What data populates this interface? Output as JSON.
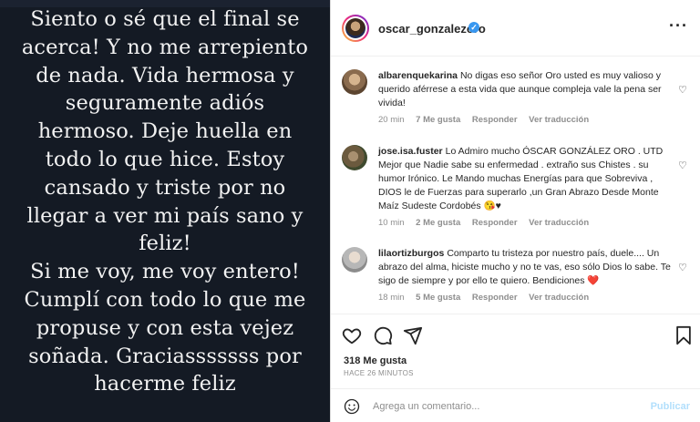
{
  "story": {
    "lines": [
      "Siento o sé que el final se",
      "acerca! Y no me arrepiento",
      "de nada. Vida hermosa y",
      "seguramente adiós",
      "hermoso. Deje huella en",
      "todo lo que hice. Estoy",
      "cansado y triste por no",
      "llegar a ver mi país sano y",
      "feliz!",
      "Si me voy, me voy entero!",
      "Cumplí con todo lo que me",
      "propuse y con esta vejez",
      "soñada. Graciasssssss por",
      "hacerme feliz"
    ]
  },
  "header": {
    "username": "oscar_gonzalezoro",
    "verified_icon": "verified-badge-icon",
    "more_icon": "more-options-icon"
  },
  "comments": [
    {
      "user": "albarenquekarina",
      "text": "No digas eso señor Oro usted es muy valioso y querido aférrese a esta vida que aunque compleja vale la pena ser vivida!",
      "time": "20 min",
      "likes": "7 Me gusta",
      "reply": "Responder",
      "translate": "Ver traducción",
      "avatar_color": "#8a6b4e"
    },
    {
      "user": "jose.isa.fuster",
      "text": "Lo Admiro mucho ÓSCAR GONZÁLEZ ORO . UTD Mejor que Nadie sabe su enfermedad . extraño sus Chistes . su humor Irónico. Le Mando muchas Energías para que Sobreviva , DIOS le de Fuerzas para superarlo ,un Gran Abrazo Desde Monte Maíz Sudeste Cordobés 😘♥",
      "time": "10 min",
      "likes": "2 Me gusta",
      "reply": "Responder",
      "translate": "Ver traducción",
      "avatar_color": "#6b5a3e"
    },
    {
      "user": "lilaortizburgos",
      "text": "Comparto tu tristeza por nuestro país, duele.... Un abrazo del alma, hiciste mucho y no te vas, eso sólo Dios lo sabe. Te sigo de siempre y por ello te quiero. Bendiciones ❤️",
      "time": "18 min",
      "likes": "5 Me gusta",
      "reply": "Responder",
      "translate": "Ver traducción",
      "avatar_color": "#b7b7b7"
    }
  ],
  "actions": {
    "like_icon": "heart-icon",
    "comment_icon": "comment-icon",
    "share_icon": "share-icon",
    "save_icon": "bookmark-icon"
  },
  "likes_count": "318 Me gusta",
  "time_ago": "HACE 26 MINUTOS",
  "add_comment": {
    "emoji_icon": "emoji-icon",
    "placeholder": "Agrega un comentario...",
    "publish_label": "Publicar"
  },
  "colors": {
    "story_bg": "#141a24",
    "link_blue": "#3897f0",
    "publish_disabled": "#b2dffc"
  }
}
